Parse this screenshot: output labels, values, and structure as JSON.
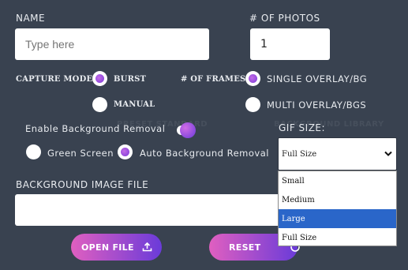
{
  "form": {
    "name_label": "NAME",
    "name_placeholder": "Type here",
    "photos_label": "# OF PHOTOS",
    "photos_value": "1",
    "capture_mode_label": "CAPTURE MODE:",
    "capture_options": [
      "BURST",
      "MANUAL"
    ],
    "capture_selected": "BURST",
    "frames_label": "# OF FRAMES:",
    "frames_options": [
      "SINGLE OVERLAY/BG",
      "MULTI OVERLAY/BGS"
    ],
    "frames_selected": "SINGLE OVERLAY/BG",
    "bg_removal_label": "Enable Background Removal",
    "bg_removal_enabled": true,
    "bg_modes": [
      "Green Screen",
      "Auto Background Removal"
    ],
    "bg_mode_selected": "Auto Background Removal",
    "gif_size_label": "GIF SIZE:",
    "gif_size_value": "Full Size",
    "gif_size_options": [
      "Small",
      "Medium",
      "Large",
      "Full Size"
    ],
    "gif_size_highlighted": "Large",
    "bg_image_label": "BACKGROUND IMAGE FILE",
    "bg_image_value": "",
    "open_file_label": "OPEN FILE",
    "reset_label": "RESET"
  },
  "colors": {
    "background": "#394250",
    "accent_start": "#e05fc0",
    "accent_end": "#6a3bd9",
    "dropdown_highlight": "#2a66c9"
  }
}
